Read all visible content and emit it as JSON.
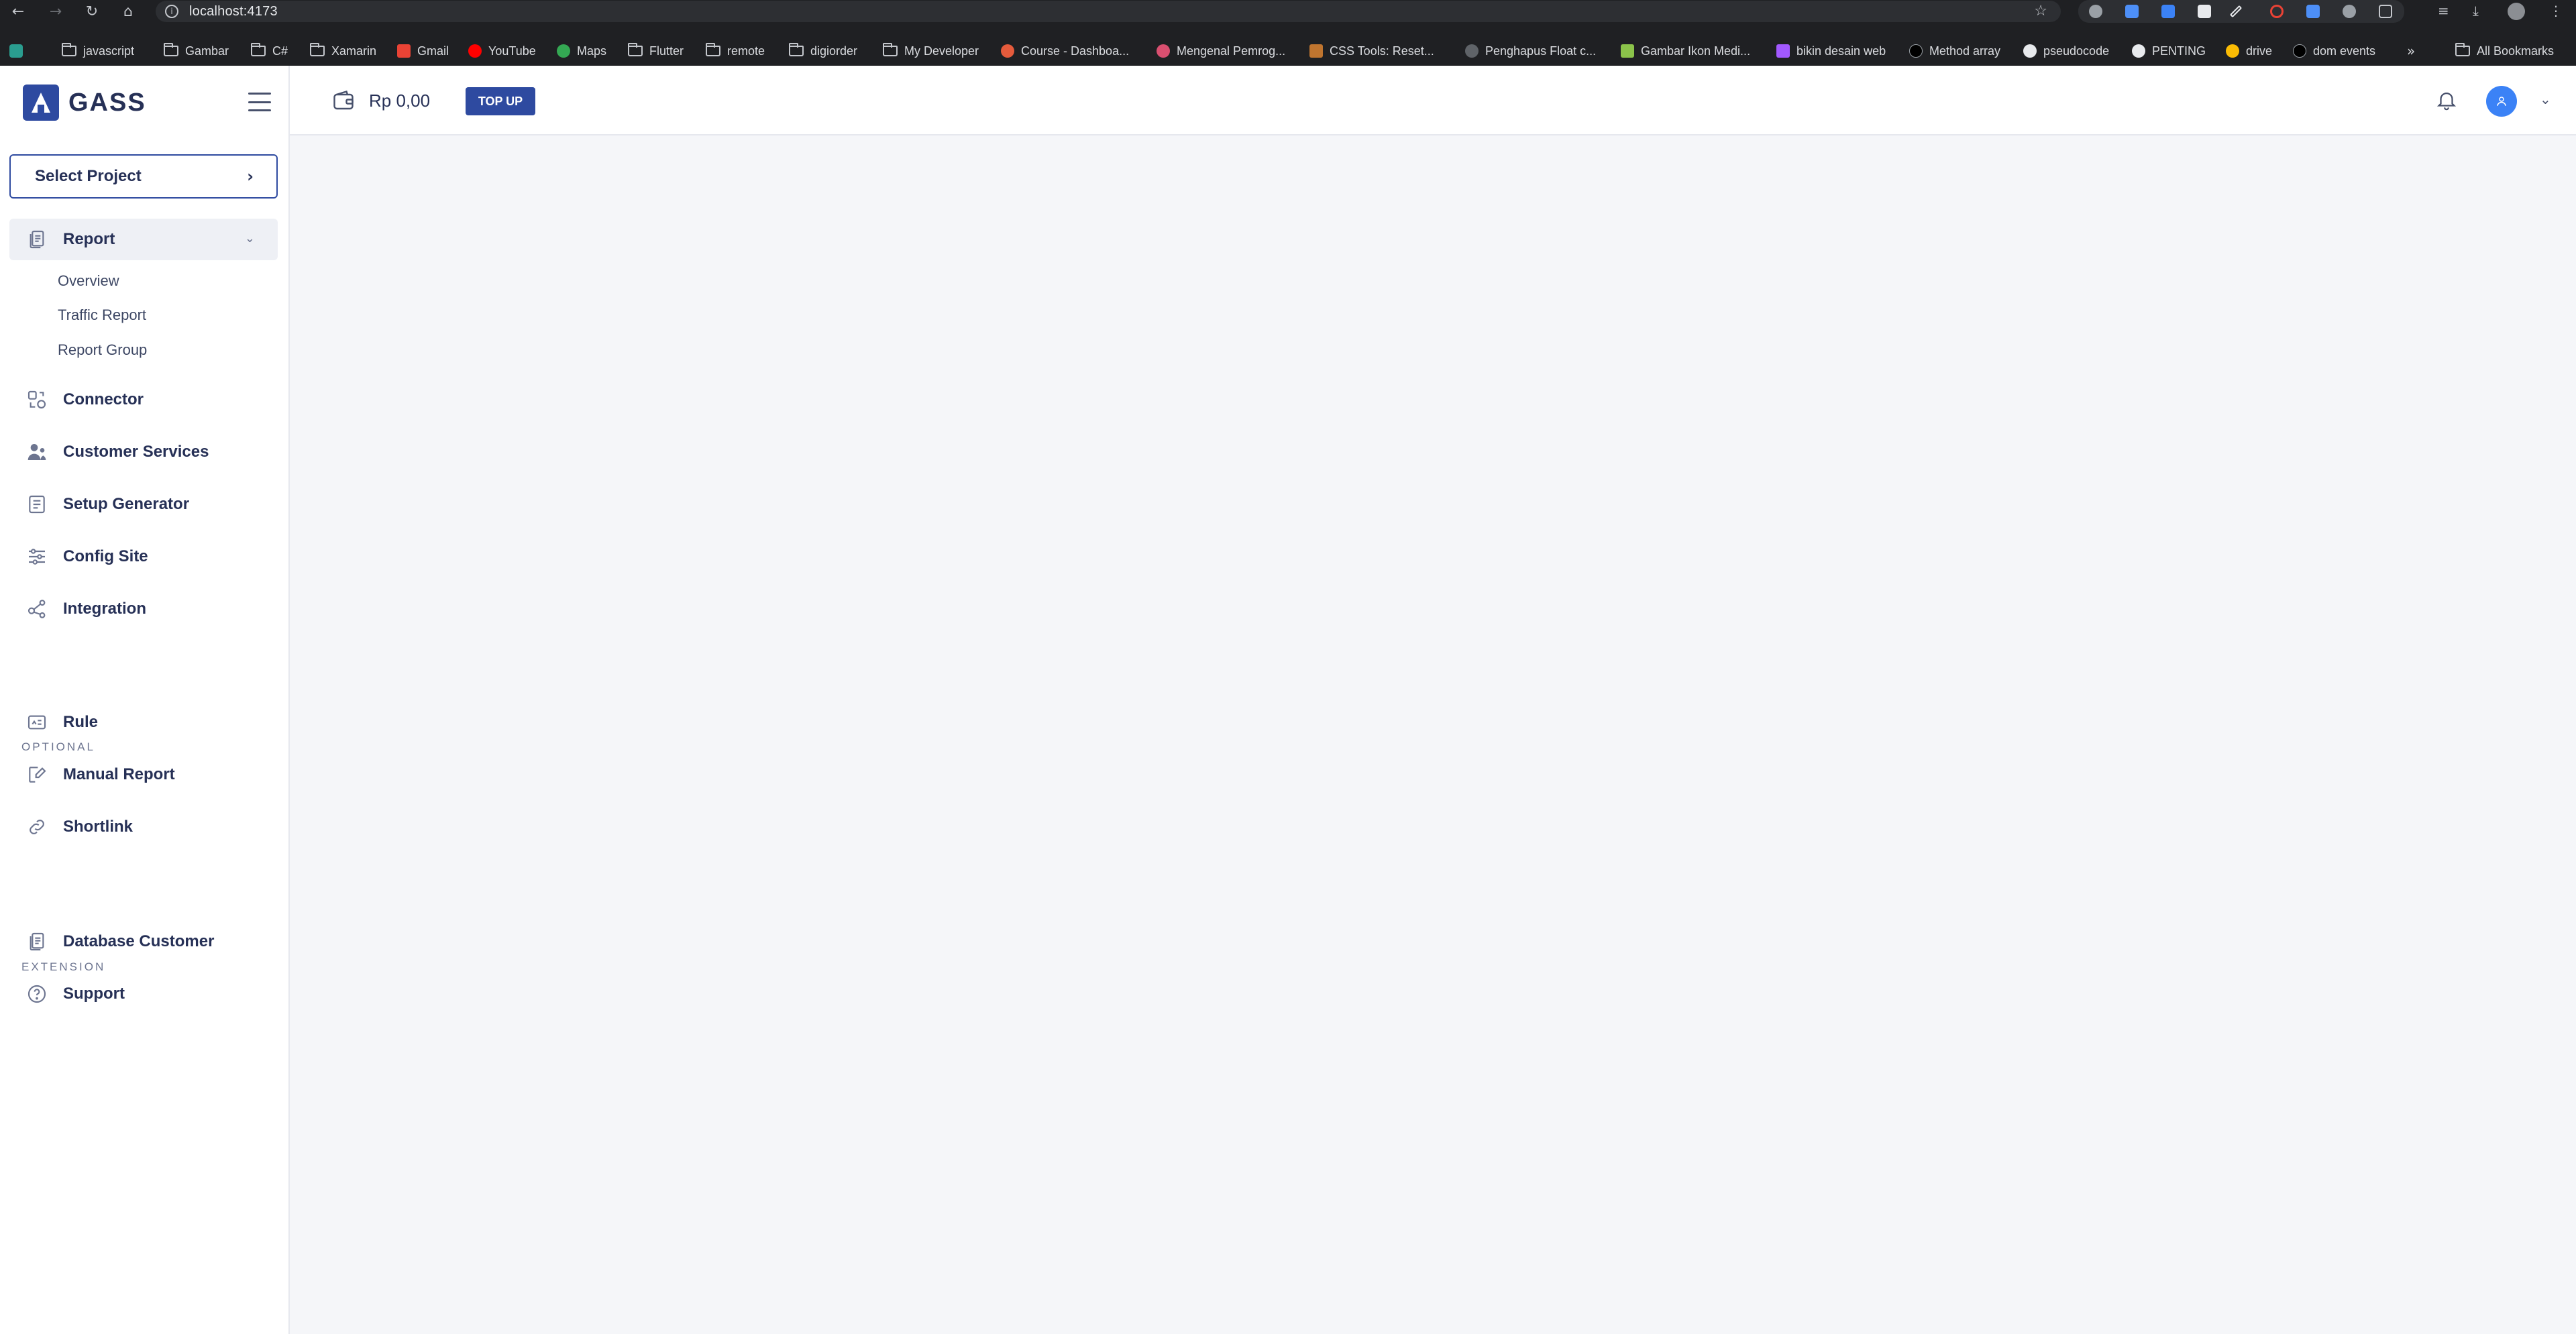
{
  "browser": {
    "url": "localhost:4173",
    "bookmarks": [
      {
        "label": "javascript",
        "type": "folder"
      },
      {
        "label": "Gambar",
        "type": "folder"
      },
      {
        "label": "C#",
        "type": "folder"
      },
      {
        "label": "Xamarin",
        "type": "folder"
      },
      {
        "label": "Gmail",
        "type": "site"
      },
      {
        "label": "YouTube",
        "type": "site"
      },
      {
        "label": "Maps",
        "type": "site"
      },
      {
        "label": "Flutter",
        "type": "folder"
      },
      {
        "label": "remote",
        "type": "folder"
      },
      {
        "label": "digiorder",
        "type": "folder"
      },
      {
        "label": "My Developer",
        "type": "folder"
      },
      {
        "label": "Course - Dashboa...",
        "type": "site"
      },
      {
        "label": "Mengenal Pemrog...",
        "type": "site"
      },
      {
        "label": "CSS Tools: Reset...",
        "type": "site"
      },
      {
        "label": "Penghapus Float c...",
        "type": "site"
      },
      {
        "label": "Gambar Ikon Medi...",
        "type": "site"
      },
      {
        "label": "bikin desain web",
        "type": "site"
      },
      {
        "label": "Method array",
        "type": "site"
      },
      {
        "label": "pseudocode",
        "type": "site"
      },
      {
        "label": "PENTING",
        "type": "site"
      },
      {
        "label": "drive",
        "type": "site"
      },
      {
        "label": "dom events",
        "type": "site"
      }
    ],
    "all_bookmarks": "All Bookmarks"
  },
  "app": {
    "brand": "GASS",
    "select_project": "Select Project",
    "menu": {
      "report": "Report",
      "report_sub": [
        "Overview",
        "Traffic Report",
        "Report Group"
      ],
      "connector": "Connector",
      "customer_services": "Customer Services",
      "setup_generator": "Setup Generator",
      "config_site": "Config Site",
      "integration": "Integration",
      "optional_title": "OPTIONAL",
      "rule": "Rule",
      "manual_report": "Manual Report",
      "shortlink": "Shortlink",
      "extension_title": "EXTENSION",
      "database_customer": "Database Customer",
      "support": "Support"
    },
    "header": {
      "balance": "Rp 0,00",
      "topup": "TOP UP"
    },
    "colors": {
      "primary": "#2e4aa0",
      "avatar": "#3b82f6",
      "content_bg": "#f5f6f9"
    }
  }
}
